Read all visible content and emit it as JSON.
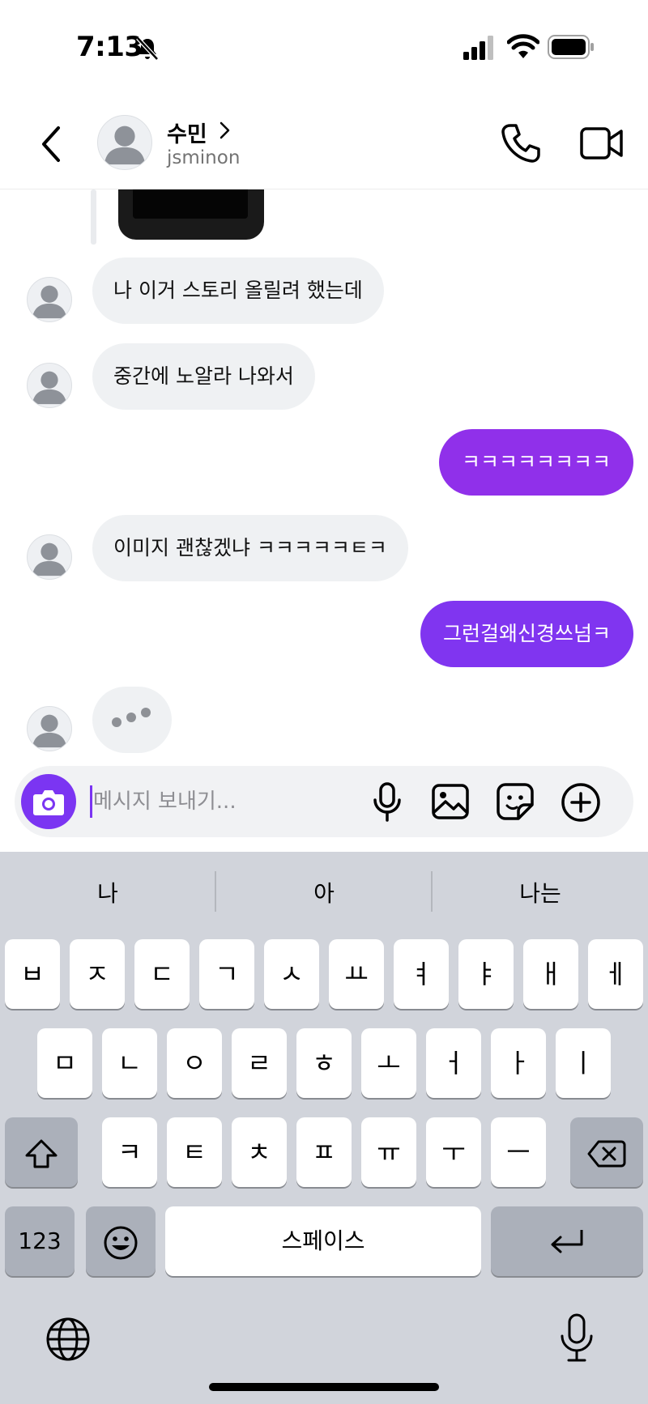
{
  "status_bar": {
    "time": "7:13",
    "icons": [
      "bell-slash-icon",
      "signal-icon",
      "wifi-icon",
      "battery-icon"
    ]
  },
  "header": {
    "name": "수민",
    "username": "jsminon",
    "icons": [
      "back-icon",
      "chevron-right-icon",
      "phone-icon",
      "video-icon"
    ]
  },
  "messages": [
    {
      "from": "them",
      "text": "나 이거 스토리 올릴려 했는데"
    },
    {
      "from": "them",
      "text": "중간에 노알라 나와서"
    },
    {
      "from": "me",
      "text": "ㅋㅋㅋㅋㅋㅋㅋㅋ"
    },
    {
      "from": "them",
      "text": "이미지 괜찮겠냐 ㅋㅋㅋㅋㅋㅌㅋ"
    },
    {
      "from": "me",
      "text": "그런걸왜신경쓰넘ㅋ"
    }
  ],
  "composer": {
    "placeholder": "메시지 보내기...",
    "icons": [
      "camera-icon",
      "mic-icon",
      "gallery-icon",
      "sticker-icon",
      "add-icon"
    ]
  },
  "keyboard": {
    "suggestions": [
      "나",
      "아",
      "나는"
    ],
    "row1": [
      "ㅂ",
      "ㅈ",
      "ㄷ",
      "ㄱ",
      "ㅅ",
      "ㅛ",
      "ㅕ",
      "ㅑ",
      "ㅐ",
      "ㅔ"
    ],
    "row2": [
      "ㅁ",
      "ㄴ",
      "ㅇ",
      "ㄹ",
      "ㅎ",
      "ㅗ",
      "ㅓ",
      "ㅏ",
      "ㅣ"
    ],
    "row3": [
      "ㅋ",
      "ㅌ",
      "ㅊ",
      "ㅍ",
      "ㅠ",
      "ㅜ",
      "ㅡ"
    ],
    "numbers_key": "123",
    "space_key": "스페이스"
  },
  "colors": {
    "accent": "#8a34ee",
    "bubble_in": "#eff1f3",
    "keyboard_bg": "#d1d4db"
  }
}
